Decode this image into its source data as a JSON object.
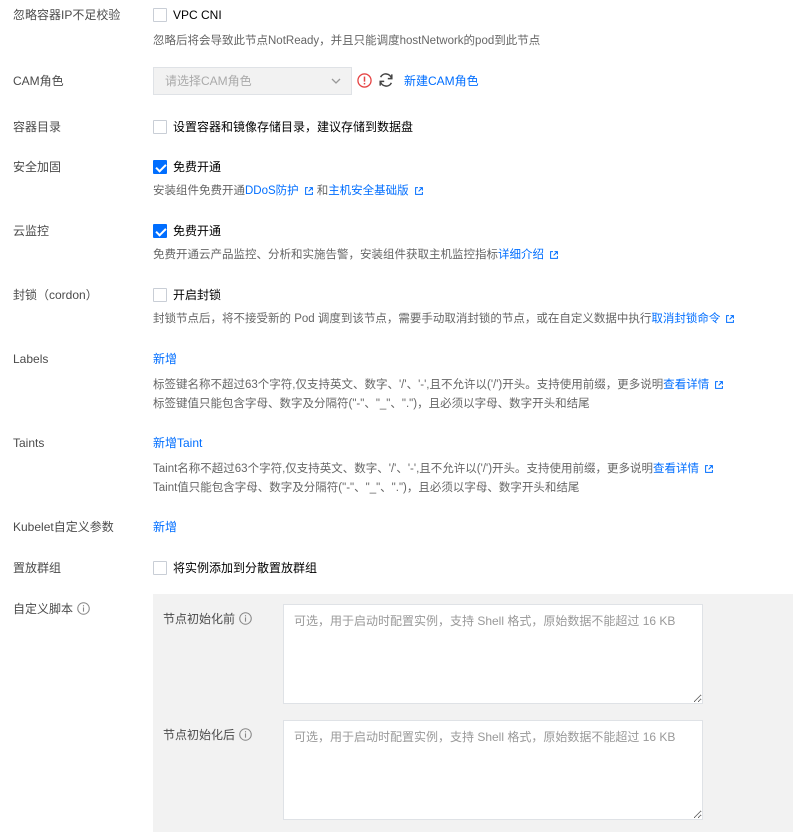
{
  "ignore_ip": {
    "label": "忽略容器IP不足校验",
    "checkbox_text": "VPC CNI",
    "hint": "忽略后将会导致此节点NotReady，并且只能调度hostNetwork的pod到此节点"
  },
  "cam": {
    "label": "CAM角色",
    "placeholder": "请选择CAM角色",
    "new_link": "新建CAM角色"
  },
  "container_dir": {
    "label": "容器目录",
    "checkbox_text": "设置容器和镜像存储目录，建议存储到数据盘"
  },
  "security": {
    "label": "安全加固",
    "checkbox_text": "免费开通",
    "checked": true,
    "hint_prefix": "安装组件免费开通",
    "link1": "DDoS防护",
    "hint_mid": "和",
    "link2": "主机安全基础版"
  },
  "monitor": {
    "label": "云监控",
    "checkbox_text": "免费开通",
    "checked": true,
    "hint_prefix": "免费开通云产品监控、分析和实施告警，安装组件获取主机监控指标",
    "link": "详细介绍"
  },
  "cordon": {
    "label": "封锁（cordon）",
    "checkbox_text": "开启封锁",
    "hint_prefix": "封锁节点后，将不接受新的 Pod 调度到该节点，需要手动取消封锁的节点，或在自定义数据中执行",
    "link": "取消封锁命令"
  },
  "labels": {
    "label": "Labels",
    "add": "新增",
    "hint1_prefix": "标签键名称不超过63个字符,仅支持英文、数字、'/'、'-',且不允许以('/')开头。支持使用前缀，更多说明",
    "hint1_link": "查看详情",
    "hint2": "标签键值只能包含字母、数字及分隔符(\"-\"、\"_\"、\".\")，且必须以字母、数字开头和结尾"
  },
  "taints": {
    "label": "Taints",
    "add": "新增Taint",
    "hint1_prefix": "Taint名称不超过63个字符,仅支持英文、数字、'/'、'-',且不允许以('/')开头。支持使用前缀，更多说明",
    "hint1_link": "查看详情",
    "hint2": "Taint值只能包含字母、数字及分隔符(\"-\"、\"_\"、\".\")，且必须以字母、数字开头和结尾"
  },
  "kubelet": {
    "label": "Kubelet自定义参数",
    "add": "新增"
  },
  "placement": {
    "label": "置放群组",
    "checkbox_text": "将实例添加到分散置放群组"
  },
  "script": {
    "label": "自定义脚本",
    "before_label": "节点初始化前",
    "after_label": "节点初始化后",
    "placeholder": "可选，用于启动时配置实例，支持 Shell 格式，原始数据不能超过 16 KB"
  },
  "colors": {
    "accent": "#006eff",
    "error": "#e54545",
    "hint": "#666666"
  }
}
